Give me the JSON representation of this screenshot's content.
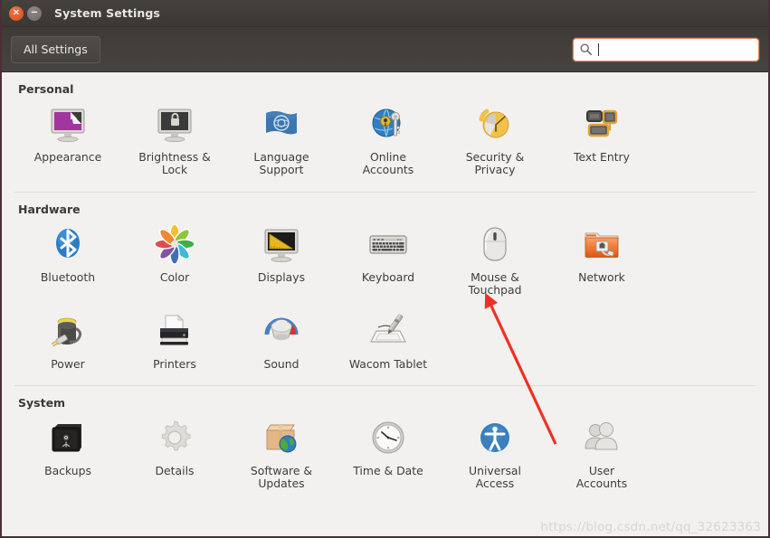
{
  "window": {
    "title": "System Settings",
    "close_icon": "close-icon",
    "minimize_icon": "minimize-icon",
    "close_glyph": "×",
    "minimize_glyph": "−"
  },
  "toolbar": {
    "all_settings_label": "All Settings",
    "search_icon": "search-icon",
    "search_value": "",
    "search_placeholder": ""
  },
  "sections": [
    {
      "title": "Personal",
      "items": [
        {
          "label": "Appearance",
          "icon": "appearance-icon"
        },
        {
          "label": "Brightness &\nLock",
          "icon": "brightness-lock-icon"
        },
        {
          "label": "Language\nSupport",
          "icon": "language-support-icon"
        },
        {
          "label": "Online\nAccounts",
          "icon": "online-accounts-icon"
        },
        {
          "label": "Security &\nPrivacy",
          "icon": "security-privacy-icon"
        },
        {
          "label": "Text Entry",
          "icon": "text-entry-icon"
        }
      ]
    },
    {
      "title": "Hardware",
      "items": [
        {
          "label": "Bluetooth",
          "icon": "bluetooth-icon"
        },
        {
          "label": "Color",
          "icon": "color-icon"
        },
        {
          "label": "Displays",
          "icon": "displays-icon"
        },
        {
          "label": "Keyboard",
          "icon": "keyboard-icon"
        },
        {
          "label": "Mouse &\nTouchpad",
          "icon": "mouse-touchpad-icon"
        },
        {
          "label": "Network",
          "icon": "network-icon"
        },
        {
          "label": "Power",
          "icon": "power-icon"
        },
        {
          "label": "Printers",
          "icon": "printers-icon"
        },
        {
          "label": "Sound",
          "icon": "sound-icon"
        },
        {
          "label": "Wacom Tablet",
          "icon": "wacom-tablet-icon"
        }
      ]
    },
    {
      "title": "System",
      "items": [
        {
          "label": "Backups",
          "icon": "backups-icon"
        },
        {
          "label": "Details",
          "icon": "details-icon"
        },
        {
          "label": "Software &\nUpdates",
          "icon": "software-updates-icon"
        },
        {
          "label": "Time & Date",
          "icon": "time-date-icon"
        },
        {
          "label": "Universal\nAccess",
          "icon": "universal-access-icon"
        },
        {
          "label": "User\nAccounts",
          "icon": "user-accounts-icon"
        }
      ]
    }
  ],
  "annotation": {
    "arrow_color": "#ee3124",
    "arrow_target": "Mouse & Touchpad"
  },
  "watermark": {
    "text": "https://blog.csdn.net/qq_32623363"
  },
  "colors": {
    "titlebar": "#3e3b37",
    "close_button": "#d9491c",
    "search_focus_border": "#e08a5a",
    "content_bg": "#f2f1ef",
    "accent_orange": "#dd4814"
  }
}
